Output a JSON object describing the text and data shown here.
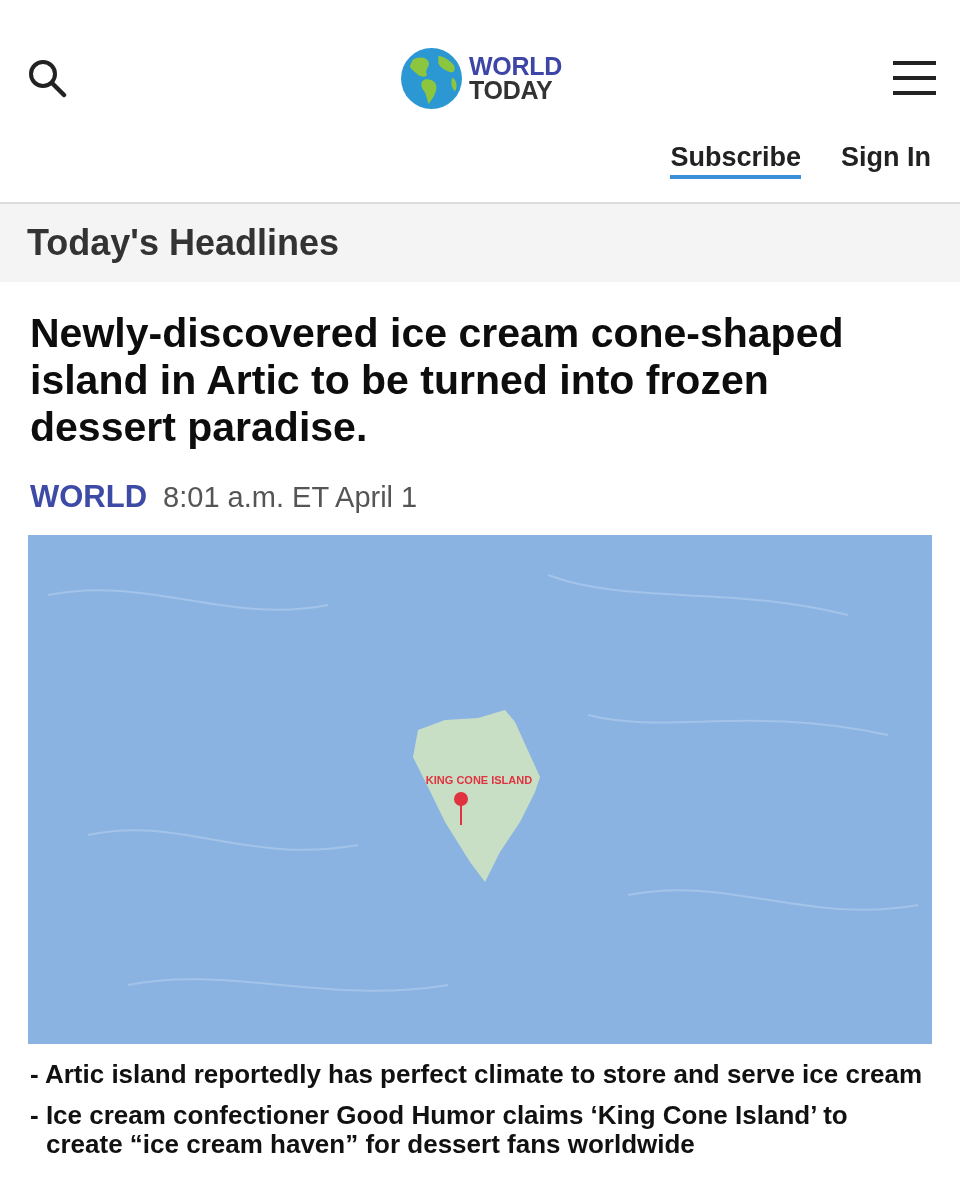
{
  "header": {
    "logo": {
      "lines": [
        "WORLD",
        "TODAY"
      ]
    },
    "nav_links": [
      {
        "label": "Subscribe",
        "highlighted": true
      },
      {
        "label": "Sign In",
        "highlighted": false
      }
    ]
  },
  "section": {
    "title": "Today's Headlines"
  },
  "article": {
    "headline": "Newly-discovered ice cream cone-shaped island in Artic to be turned into frozen dessert paradise.",
    "category": "WORLD",
    "timestamp": "8:01 a.m. ET April 1",
    "map": {
      "label": "KING CONE ISLAND"
    },
    "bullets": [
      "- Artic island reportedly has perfect climate to store and serve ice cream",
      "- Ice cream confectioner Good Humor claims ‘King Cone Island’ to create “ice cream haven” for dessert fans worldwide"
    ]
  }
}
